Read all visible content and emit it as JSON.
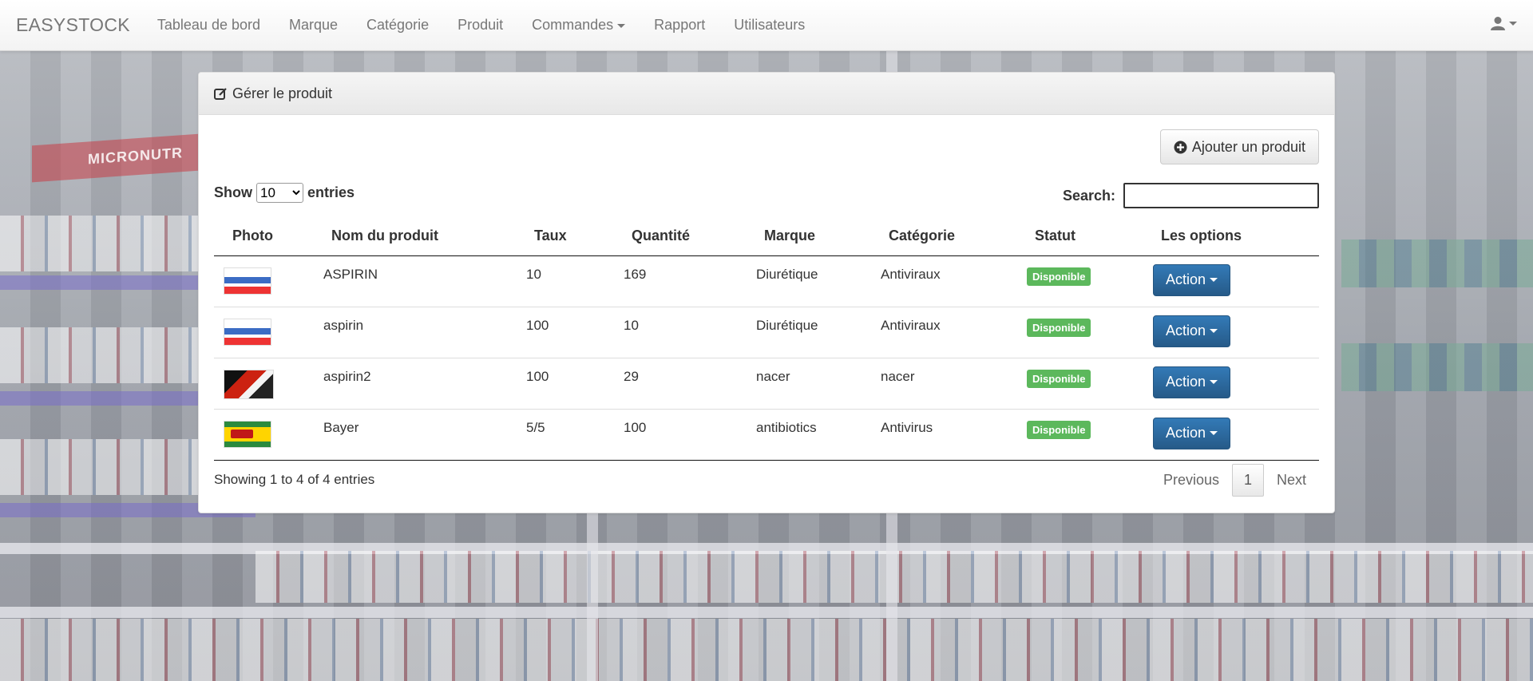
{
  "navbar": {
    "brand": "EASYSTOCK",
    "items": [
      "Tableau de bord",
      "Marque",
      "Catégorie",
      "Produit",
      "Commandes",
      "Rapport",
      "Utilisateurs"
    ]
  },
  "panel": {
    "title": "Gérer le produit",
    "add_button": "Ajouter un produit",
    "length": {
      "show": "Show",
      "value": "10",
      "entries": "entries"
    },
    "search_label": "Search:",
    "columns": [
      "Photo",
      "Nom du produit",
      "Taux",
      "Quantité",
      "Marque",
      "Catégorie",
      "Statut",
      "Les options"
    ],
    "rows": [
      {
        "name": "ASPIRIN",
        "taux": "10",
        "quantite": "169",
        "marque": "Diurétique",
        "categorie": "Antiviraux",
        "statut": "Disponible",
        "action": "Action"
      },
      {
        "name": "aspirin",
        "taux": "100",
        "quantite": "10",
        "marque": "Diurétique",
        "categorie": "Antiviraux",
        "statut": "Disponible",
        "action": "Action"
      },
      {
        "name": "aspirin2",
        "taux": "100",
        "quantite": "29",
        "marque": "nacer",
        "categorie": "nacer",
        "statut": "Disponible",
        "action": "Action"
      },
      {
        "name": "Bayer",
        "taux": "5/5",
        "quantite": "100",
        "marque": "antibiotics",
        "categorie": "Antivirus",
        "statut": "Disponible",
        "action": "Action"
      }
    ],
    "info": "Showing 1 to 4 of 4 entries",
    "pagination": {
      "previous": "Previous",
      "current": "1",
      "next": "Next"
    }
  },
  "background": {
    "shelf_sign": "MICRONUTR"
  },
  "colors": {
    "primary": "#337ab7",
    "success": "#5cb85c",
    "navbar_text": "#777777"
  }
}
